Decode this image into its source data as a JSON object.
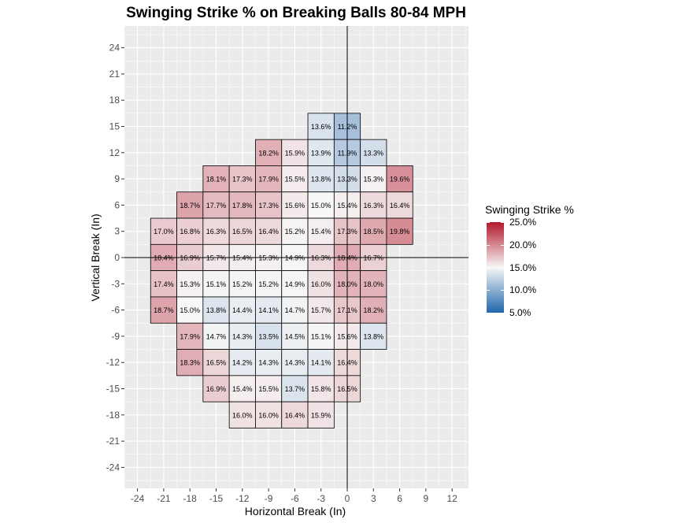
{
  "chart_data": {
    "type": "heatmap",
    "title": "Swinging Strike % on Breaking Balls 80-84 MPH",
    "xlabel": "Horizontal Break (In)",
    "ylabel": "Vertical Break (In)",
    "x_ticks": [
      -24,
      -21,
      -18,
      -15,
      -12,
      -9,
      -6,
      -3,
      0,
      3,
      6,
      9,
      12
    ],
    "y_ticks": [
      24,
      21,
      18,
      15,
      12,
      9,
      6,
      3,
      0,
      -3,
      -6,
      -9,
      -12,
      -15,
      -18,
      -21,
      -24
    ],
    "xlim": [
      -25.5,
      14
    ],
    "ylim": [
      -25.5,
      26
    ],
    "bin_size": 3,
    "reference_lines": {
      "x": 0,
      "y": 0
    },
    "legend": {
      "title": "Swinging Strike %",
      "labels": [
        "25.0%",
        "20.0%",
        "15.0%",
        "10.0%",
        "5.0%"
      ],
      "range": [
        5,
        25
      ],
      "midpoint": 15,
      "low_color": "#2166ac",
      "mid_color": "#f7f7f7",
      "high_color": "#b2182b",
      "placement": "right"
    },
    "cells": [
      {
        "x": -3,
        "y": 15,
        "value": 13.6
      },
      {
        "x": 0,
        "y": 15,
        "value": 11.2
      },
      {
        "x": -9,
        "y": 12,
        "value": 18.2
      },
      {
        "x": -6,
        "y": 12,
        "value": 15.9
      },
      {
        "x": -3,
        "y": 12,
        "value": 13.9
      },
      {
        "x": 0,
        "y": 12,
        "value": 11.9
      },
      {
        "x": 3,
        "y": 12,
        "value": 13.3
      },
      {
        "x": -15,
        "y": 9,
        "value": 18.1
      },
      {
        "x": -12,
        "y": 9,
        "value": 17.3
      },
      {
        "x": -9,
        "y": 9,
        "value": 17.9
      },
      {
        "x": -6,
        "y": 9,
        "value": 15.5
      },
      {
        "x": -3,
        "y": 9,
        "value": 13.8
      },
      {
        "x": 0,
        "y": 9,
        "value": 13.3
      },
      {
        "x": 3,
        "y": 9,
        "value": 15.3
      },
      {
        "x": 6,
        "y": 9,
        "value": 19.6
      },
      {
        "x": -18,
        "y": 6,
        "value": 18.7
      },
      {
        "x": -15,
        "y": 6,
        "value": 17.7
      },
      {
        "x": -12,
        "y": 6,
        "value": 17.8
      },
      {
        "x": -9,
        "y": 6,
        "value": 17.3
      },
      {
        "x": -6,
        "y": 6,
        "value": 15.6
      },
      {
        "x": -3,
        "y": 6,
        "value": 15.0
      },
      {
        "x": 0,
        "y": 6,
        "value": 15.4
      },
      {
        "x": 3,
        "y": 6,
        "value": 16.3
      },
      {
        "x": 6,
        "y": 6,
        "value": 16.4
      },
      {
        "x": -21,
        "y": 3,
        "value": 17.0
      },
      {
        "x": -18,
        "y": 3,
        "value": 16.8
      },
      {
        "x": -15,
        "y": 3,
        "value": 16.3
      },
      {
        "x": -12,
        "y": 3,
        "value": 16.5
      },
      {
        "x": -9,
        "y": 3,
        "value": 16.4
      },
      {
        "x": -6,
        "y": 3,
        "value": 15.2
      },
      {
        "x": -3,
        "y": 3,
        "value": 15.4
      },
      {
        "x": 0,
        "y": 3,
        "value": 17.3
      },
      {
        "x": 3,
        "y": 3,
        "value": 18.5
      },
      {
        "x": 6,
        "y": 3,
        "value": 19.8
      },
      {
        "x": -21,
        "y": 0,
        "value": 18.4
      },
      {
        "x": -18,
        "y": 0,
        "value": 16.9
      },
      {
        "x": -15,
        "y": 0,
        "value": 15.7
      },
      {
        "x": -12,
        "y": 0,
        "value": 15.4
      },
      {
        "x": -9,
        "y": 0,
        "value": 15.3
      },
      {
        "x": -6,
        "y": 0,
        "value": 14.9
      },
      {
        "x": -3,
        "y": 0,
        "value": 16.3
      },
      {
        "x": 0,
        "y": 0,
        "value": 18.4
      },
      {
        "x": 3,
        "y": 0,
        "value": 16.7
      },
      {
        "x": -21,
        "y": -3,
        "value": 17.4
      },
      {
        "x": -18,
        "y": -3,
        "value": 15.3
      },
      {
        "x": -15,
        "y": -3,
        "value": 15.1
      },
      {
        "x": -12,
        "y": -3,
        "value": 15.2
      },
      {
        "x": -9,
        "y": -3,
        "value": 15.2
      },
      {
        "x": -6,
        "y": -3,
        "value": 14.9
      },
      {
        "x": -3,
        "y": -3,
        "value": 16.0
      },
      {
        "x": 0,
        "y": -3,
        "value": 18.0
      },
      {
        "x": 3,
        "y": -3,
        "value": 18.0
      },
      {
        "x": -21,
        "y": -6,
        "value": 18.7
      },
      {
        "x": -18,
        "y": -6,
        "value": 15.0
      },
      {
        "x": -15,
        "y": -6,
        "value": 13.8
      },
      {
        "x": -12,
        "y": -6,
        "value": 14.4
      },
      {
        "x": -9,
        "y": -6,
        "value": 14.1
      },
      {
        "x": -6,
        "y": -6,
        "value": 14.7
      },
      {
        "x": -3,
        "y": -6,
        "value": 15.7
      },
      {
        "x": 0,
        "y": -6,
        "value": 17.1
      },
      {
        "x": 3,
        "y": -6,
        "value": 18.2
      },
      {
        "x": -18,
        "y": -9,
        "value": 17.9
      },
      {
        "x": -15,
        "y": -9,
        "value": 14.7
      },
      {
        "x": -12,
        "y": -9,
        "value": 14.3
      },
      {
        "x": -9,
        "y": -9,
        "value": 13.5
      },
      {
        "x": -6,
        "y": -9,
        "value": 14.5
      },
      {
        "x": -3,
        "y": -9,
        "value": 15.1
      },
      {
        "x": 0,
        "y": -9,
        "value": 15.6
      },
      {
        "x": 3,
        "y": -9,
        "value": 13.8
      },
      {
        "x": -18,
        "y": -12,
        "value": 18.3
      },
      {
        "x": -15,
        "y": -12,
        "value": 16.5
      },
      {
        "x": -12,
        "y": -12,
        "value": 14.2
      },
      {
        "x": -9,
        "y": -12,
        "value": 14.3
      },
      {
        "x": -6,
        "y": -12,
        "value": 14.3
      },
      {
        "x": -3,
        "y": -12,
        "value": 14.1
      },
      {
        "x": 0,
        "y": -12,
        "value": 16.4
      },
      {
        "x": -15,
        "y": -15,
        "value": 16.9
      },
      {
        "x": -12,
        "y": -15,
        "value": 15.4
      },
      {
        "x": -9,
        "y": -15,
        "value": 15.5
      },
      {
        "x": -6,
        "y": -15,
        "value": 13.7
      },
      {
        "x": -3,
        "y": -15,
        "value": 15.8
      },
      {
        "x": 0,
        "y": -15,
        "value": 16.5
      },
      {
        "x": -12,
        "y": -18,
        "value": 16.0
      },
      {
        "x": -9,
        "y": -18,
        "value": 16.0
      },
      {
        "x": -6,
        "y": -18,
        "value": 16.4
      },
      {
        "x": -3,
        "y": -18,
        "value": 15.9
      }
    ]
  }
}
